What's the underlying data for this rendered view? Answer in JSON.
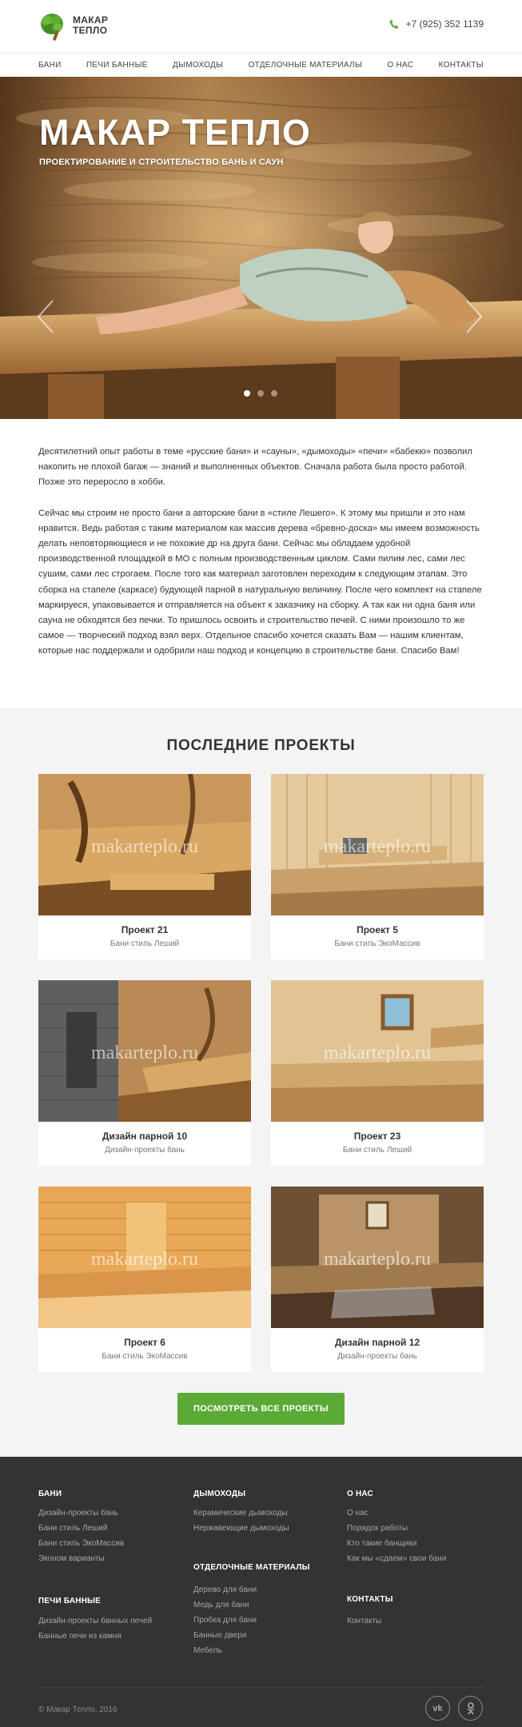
{
  "header": {
    "logo_line1": "МАКАР",
    "logo_line2": "ТЕПЛО",
    "phone": "+7 (925) 352 1139"
  },
  "nav": [
    "БАНИ",
    "ПЕЧИ БАННЫЕ",
    "ДЫМОХОДЫ",
    "ОТДЕЛОЧНЫЕ МАТЕРИАЛЫ",
    "О НАС",
    "КОНТАКТЫ"
  ],
  "hero": {
    "title": "МАКАР ТЕПЛО",
    "subtitle": "ПРОЕКТИРОВАНИЕ И СТРОИТЕЛЬСТВО БАНЬ И САУН",
    "active_slide": 1,
    "slide_count": 3
  },
  "intro": {
    "p1": "Десятилетний опыт работы в теме «русские бани» и «сауны», «дымоходы» «печи» «бабекю» позволил накопить не плохой багаж — знаний и выполненных объектов. Сначала работа была просто работой. Позже это переросло в хобби.",
    "p2": "Сейчас мы строим не просто бани а авторские бани в «стиле Лешего». К этому мы пришли и это нам нравится. Ведь работая с таким материалом как массив дерева «бревно-доска» мы имеем возможность делать неповторяющиеся и не похожие др на друга бани. Сейчас мы обладаем удобной производственной площадкой в МО с полным производственным циклом. Сами пилим лес, сами лес сушим, сами лес строгаем. После того как материал заготовлен переходим к следующим этапам. Это сборка на стапеле (каркасе) будующей парной в натуральную величину. После чего комплект на стапеле маркируеся, упаковывается и отправляется на объект к заказчику на сборку. А так как ни одна баня или сауна не обходятся без печки. То пришлось освоить и строительство печей. С ними произошло то же самое — творческий подход взял верх. Отдельное спасибо хочется сказать Вам — нашим клиентам, которые нас поддержали и одобрили наш подход и концепцию в строительстве бани. Спасибо Вам!"
  },
  "projects": {
    "title": "ПОСЛЕДНИЕ ПРОЕКТЫ",
    "watermark": "makarteplo.ru",
    "items": [
      {
        "name": "Проект 21",
        "category": "Бани стиль Леший"
      },
      {
        "name": "Проект 5",
        "category": "Бани стиль ЭкоМассив"
      },
      {
        "name": "Дизайн парной 10",
        "category": "Дизайн-проекты бань"
      },
      {
        "name": "Проект 23",
        "category": "Бани стиль Леший"
      },
      {
        "name": "Проект 6",
        "category": "Бани стиль ЭкоМассив"
      },
      {
        "name": "Дизайн парной 12",
        "category": "Дизайн-проекты бань"
      }
    ],
    "button": "ПОСМОТРЕТЬ ВСЕ ПРОЕКТЫ"
  },
  "footer": {
    "bani": {
      "title": "БАНИ",
      "links": [
        "Дизайн-проекты бань",
        "Бани стиль Леший",
        "Бани стиль ЭкоМассив",
        "Эконом варианты"
      ]
    },
    "dymokhody": {
      "title": "ДЫМОХОДЫ",
      "links": [
        "Керамические дымоходы",
        "Нержавеющие дымоходы"
      ]
    },
    "o_nas": {
      "title": "О НАС",
      "links": [
        "О нас",
        "Порядок работы",
        "Кто такие банщики",
        "Как мы «сдаем» свои бани"
      ]
    },
    "pechi": {
      "title": "ПЕЧИ БАННЫЕ",
      "links": [
        "Дизайн-проекты банных печей",
        "Банные печи из камня"
      ]
    },
    "otdelka": {
      "title": "ОТДЕЛОЧНЫЕ МАТЕРИАЛЫ",
      "links": [
        "Дерево для бани",
        "Медь для бани",
        "Пробка для бани",
        "Банные двери",
        "Мебель"
      ]
    },
    "kontakty": {
      "title": "КОНТАКТЫ",
      "links": [
        "Контакты"
      ]
    },
    "copyright": "© Макар Тепло, 2016",
    "social": [
      {
        "icon": "vk-icon",
        "label": "vk"
      },
      {
        "icon": "odnoklassniki-icon",
        "label": "ok"
      }
    ]
  },
  "colors": {
    "accent": "#5aaa35",
    "footer_bg": "#333333",
    "section_bg": "#f4f4f4"
  }
}
